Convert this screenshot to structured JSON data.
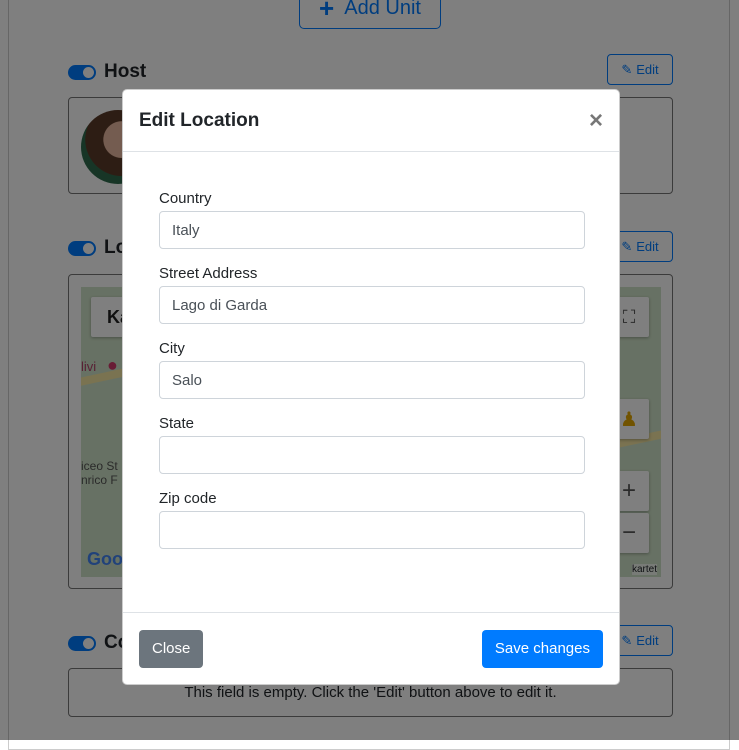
{
  "page": {
    "add_unit_label": "Add Unit",
    "sections": [
      {
        "title": "Host",
        "edit_label": "Edit"
      },
      {
        "title": "Lo",
        "edit_label": "Edit",
        "map": {
          "search_fragment": "Ka",
          "labels": [
            "livi",
            "iceo St",
            "nrico F",
            "kartet"
          ],
          "google_fragment": "Goo"
        }
      },
      {
        "title": "Co",
        "edit_label": "Edit",
        "empty_text": "This field is empty. Click the 'Edit' button above to edit it."
      }
    ]
  },
  "modal": {
    "title": "Edit Location",
    "fields": [
      {
        "label": "Country",
        "value": "Italy"
      },
      {
        "label": "Street Address",
        "value": "Lago di Garda"
      },
      {
        "label": "City",
        "value": "Salo"
      },
      {
        "label": "State",
        "value": ""
      },
      {
        "label": "Zip code",
        "value": ""
      }
    ],
    "close_label": "Close",
    "save_label": "Save changes"
  },
  "colors": {
    "primary": "#007bff",
    "secondary": "#6c757d"
  }
}
